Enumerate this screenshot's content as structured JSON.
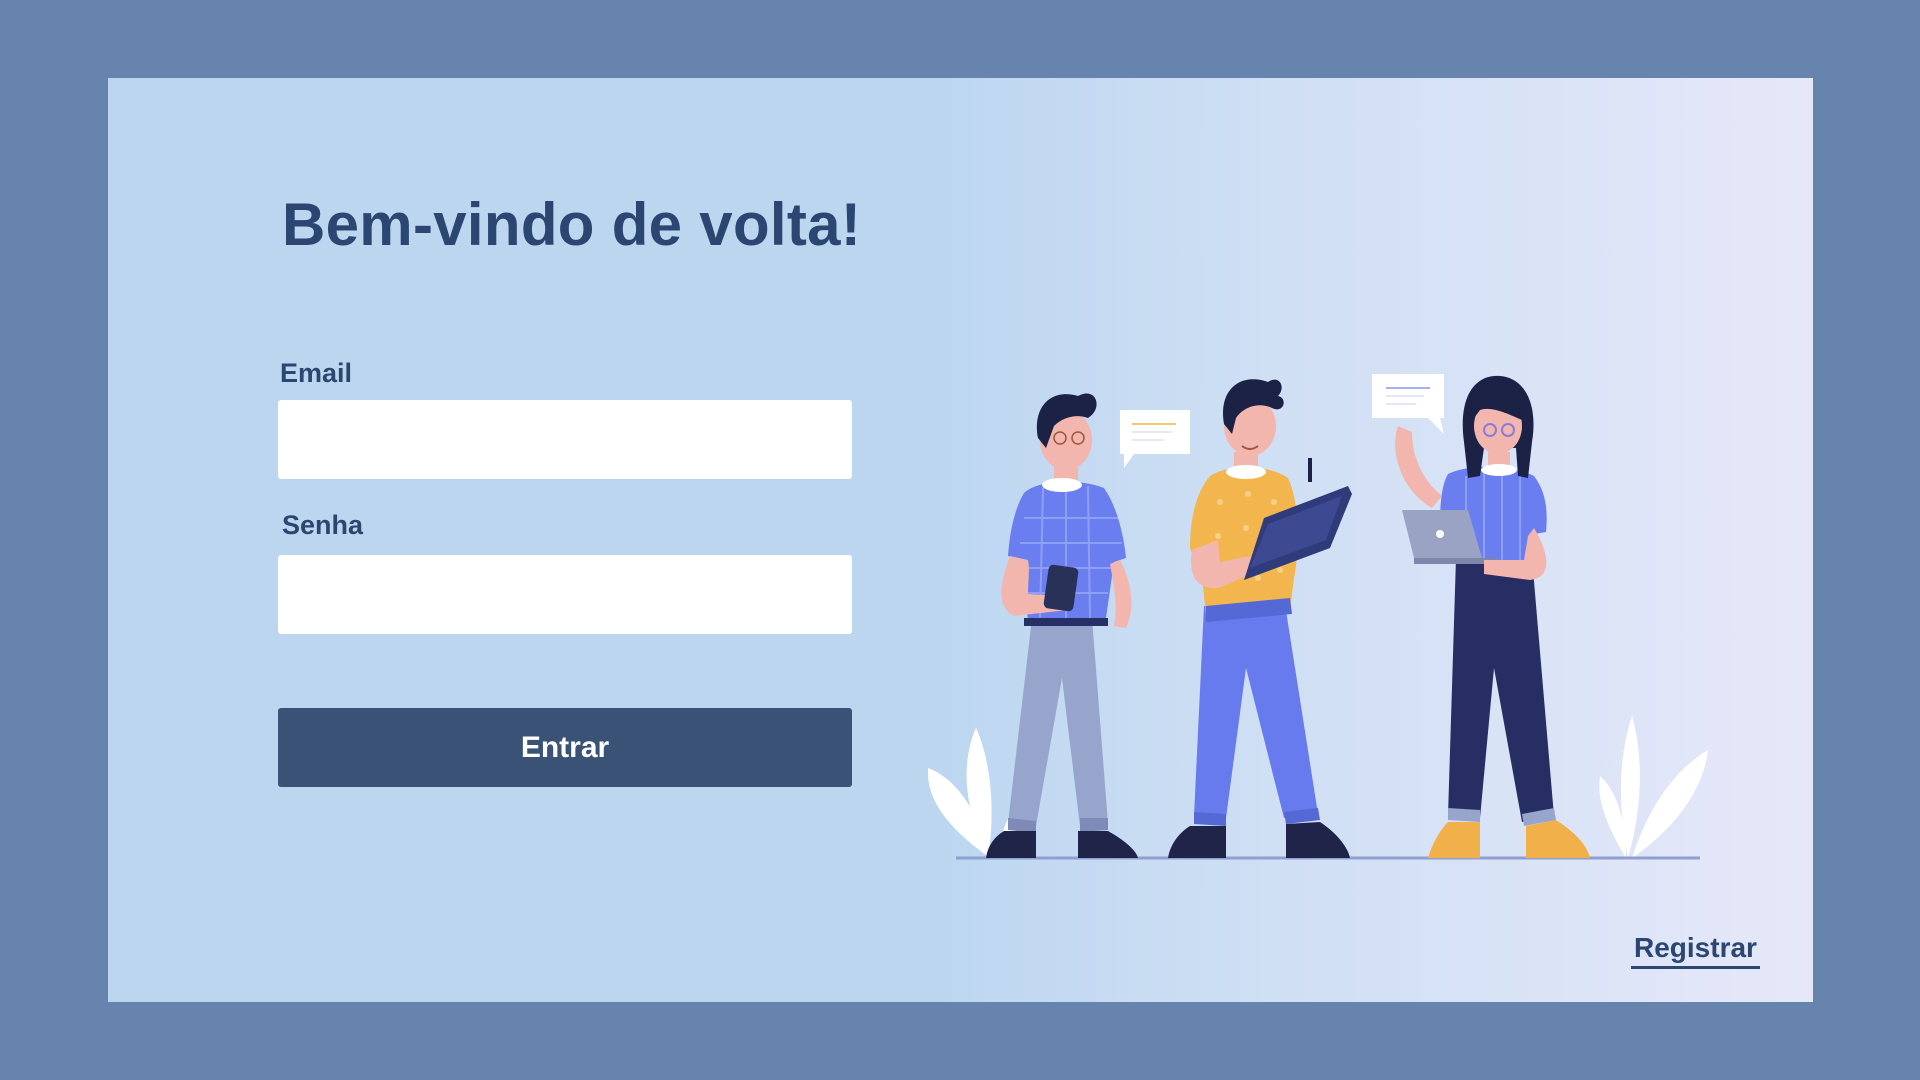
{
  "login": {
    "title": "Bem-vindo de volta!",
    "email_label": "Email",
    "email_value": "",
    "password_label": "Senha",
    "password_value": "",
    "submit_label": "Entrar",
    "register_link": "Registrar"
  },
  "colors": {
    "frame_background": "#6784af",
    "panel_background": "#bcd6f0",
    "primary_text": "#2b4670",
    "button_background": "#395275",
    "button_text": "#ffffff",
    "input_background": "#ffffff"
  },
  "illustration": {
    "icon": "team-collaboration-illustration"
  }
}
